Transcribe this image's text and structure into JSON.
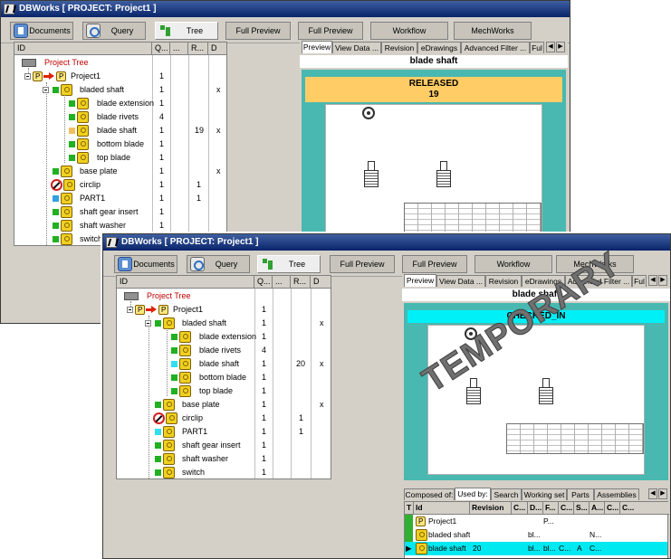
{
  "window1": {
    "title": "DBWorks [ PROJECT: Project1 ]",
    "toolbar": {
      "documents": "Documents",
      "query": "Query",
      "tree": "Tree",
      "full_preview_1": "Full Preview",
      "full_preview_2": "Full Preview",
      "workflow": "Workflow",
      "mechworks": "MechWorks"
    },
    "tree": {
      "columns": [
        "ID",
        "Q...",
        "...",
        "R...",
        "D"
      ],
      "root": "Project Tree",
      "rows": [
        {
          "name": "Project1",
          "q": "1",
          "r": "",
          "d": ""
        },
        {
          "name": "bladed shaft",
          "q": "1",
          "r": "",
          "d": "x"
        },
        {
          "name": "blade extension",
          "q": "1",
          "r": "",
          "d": ""
        },
        {
          "name": "blade rivets",
          "q": "4",
          "r": "",
          "d": ""
        },
        {
          "name": "blade shaft",
          "q": "1",
          "r": "19",
          "d": "x"
        },
        {
          "name": "bottom blade",
          "q": "1",
          "r": "",
          "d": ""
        },
        {
          "name": "top blade",
          "q": "1",
          "r": "",
          "d": ""
        },
        {
          "name": "base plate",
          "q": "1",
          "r": "",
          "d": "x"
        },
        {
          "name": "circlip",
          "q": "1",
          "r": "1",
          "d": ""
        },
        {
          "name": "PART1",
          "q": "1",
          "r": "1",
          "d": ""
        },
        {
          "name": "shaft gear insert",
          "q": "1",
          "r": "",
          "d": ""
        },
        {
          "name": "shaft washer",
          "q": "1",
          "r": "",
          "d": ""
        },
        {
          "name": "switch",
          "q": "1",
          "r": "",
          "d": ""
        }
      ]
    },
    "preview": {
      "tabs": [
        "Preview",
        "View Data ...",
        "Revision",
        "eDrawings",
        "Advanced Filter ...",
        "Ful"
      ],
      "scroll_left": "◀",
      "scroll_right": "▶",
      "title": "blade shaft",
      "status": "RELEASED",
      "revision": "19",
      "status_color": "#ffcc66"
    }
  },
  "window2": {
    "title": "DBWorks [ PROJECT: Project1 ]",
    "toolbar": {
      "documents": "Documents",
      "query": "Query",
      "tree": "Tree",
      "full_preview_1": "Full Preview",
      "full_preview_2": "Full Preview",
      "workflow": "Workflow",
      "mechworks": "MechWorks"
    },
    "tree": {
      "columns": [
        "ID",
        "Q...",
        "...",
        "R...",
        "D"
      ],
      "root": "Project Tree",
      "rows": [
        {
          "name": "Project1",
          "q": "1",
          "r": "",
          "d": ""
        },
        {
          "name": "bladed shaft",
          "q": "1",
          "r": "",
          "d": "x"
        },
        {
          "name": "blade extension",
          "q": "1",
          "r": "",
          "d": ""
        },
        {
          "name": "blade rivets",
          "q": "4",
          "r": "",
          "d": ""
        },
        {
          "name": "blade shaft",
          "q": "1",
          "r": "20",
          "d": "x"
        },
        {
          "name": "bottom blade",
          "q": "1",
          "r": "",
          "d": ""
        },
        {
          "name": "top blade",
          "q": "1",
          "r": "",
          "d": ""
        },
        {
          "name": "base plate",
          "q": "1",
          "r": "",
          "d": "x"
        },
        {
          "name": "circlip",
          "q": "1",
          "r": "1",
          "d": ""
        },
        {
          "name": "PART1",
          "q": "1",
          "r": "1",
          "d": ""
        },
        {
          "name": "shaft gear insert",
          "q": "1",
          "r": "",
          "d": ""
        },
        {
          "name": "shaft washer",
          "q": "1",
          "r": "",
          "d": ""
        },
        {
          "name": "switch",
          "q": "1",
          "r": "",
          "d": ""
        }
      ]
    },
    "preview": {
      "tabs": [
        "Preview",
        "View Data ...",
        "Revision",
        "eDrawings",
        "Advanced Filter ...",
        "Ful"
      ],
      "scroll_left": "◀",
      "scroll_right": "▶",
      "title": "blade shaft",
      "status": "CHECKED_IN",
      "watermark": "TEMPORARY",
      "status_color": "#00f0f8"
    },
    "bottom_tabs": [
      "Composed of:",
      "Used by:",
      "Search",
      "Working set",
      "Parts",
      "Assemblies"
    ],
    "bottom_grid": {
      "columns": [
        "T",
        "Id",
        "Revision",
        "C...",
        "D...",
        "F...",
        "C...",
        "S...",
        "A...",
        "C...",
        "C..."
      ],
      "rows": [
        {
          "id": "Project1",
          "rev": "",
          "cells": [
            "",
            "",
            "P...",
            "",
            "",
            "",
            "",
            ""
          ]
        },
        {
          "id": "bladed shaft",
          "rev": "",
          "cells": [
            "",
            "bl...",
            "",
            "",
            "",
            "N...",
            "",
            ""
          ]
        },
        {
          "id": "blade shaft",
          "rev": "20",
          "cells": [
            "",
            "bl...",
            "bl...",
            "C...",
            "A",
            "C...",
            "",
            ""
          ]
        }
      ]
    }
  }
}
